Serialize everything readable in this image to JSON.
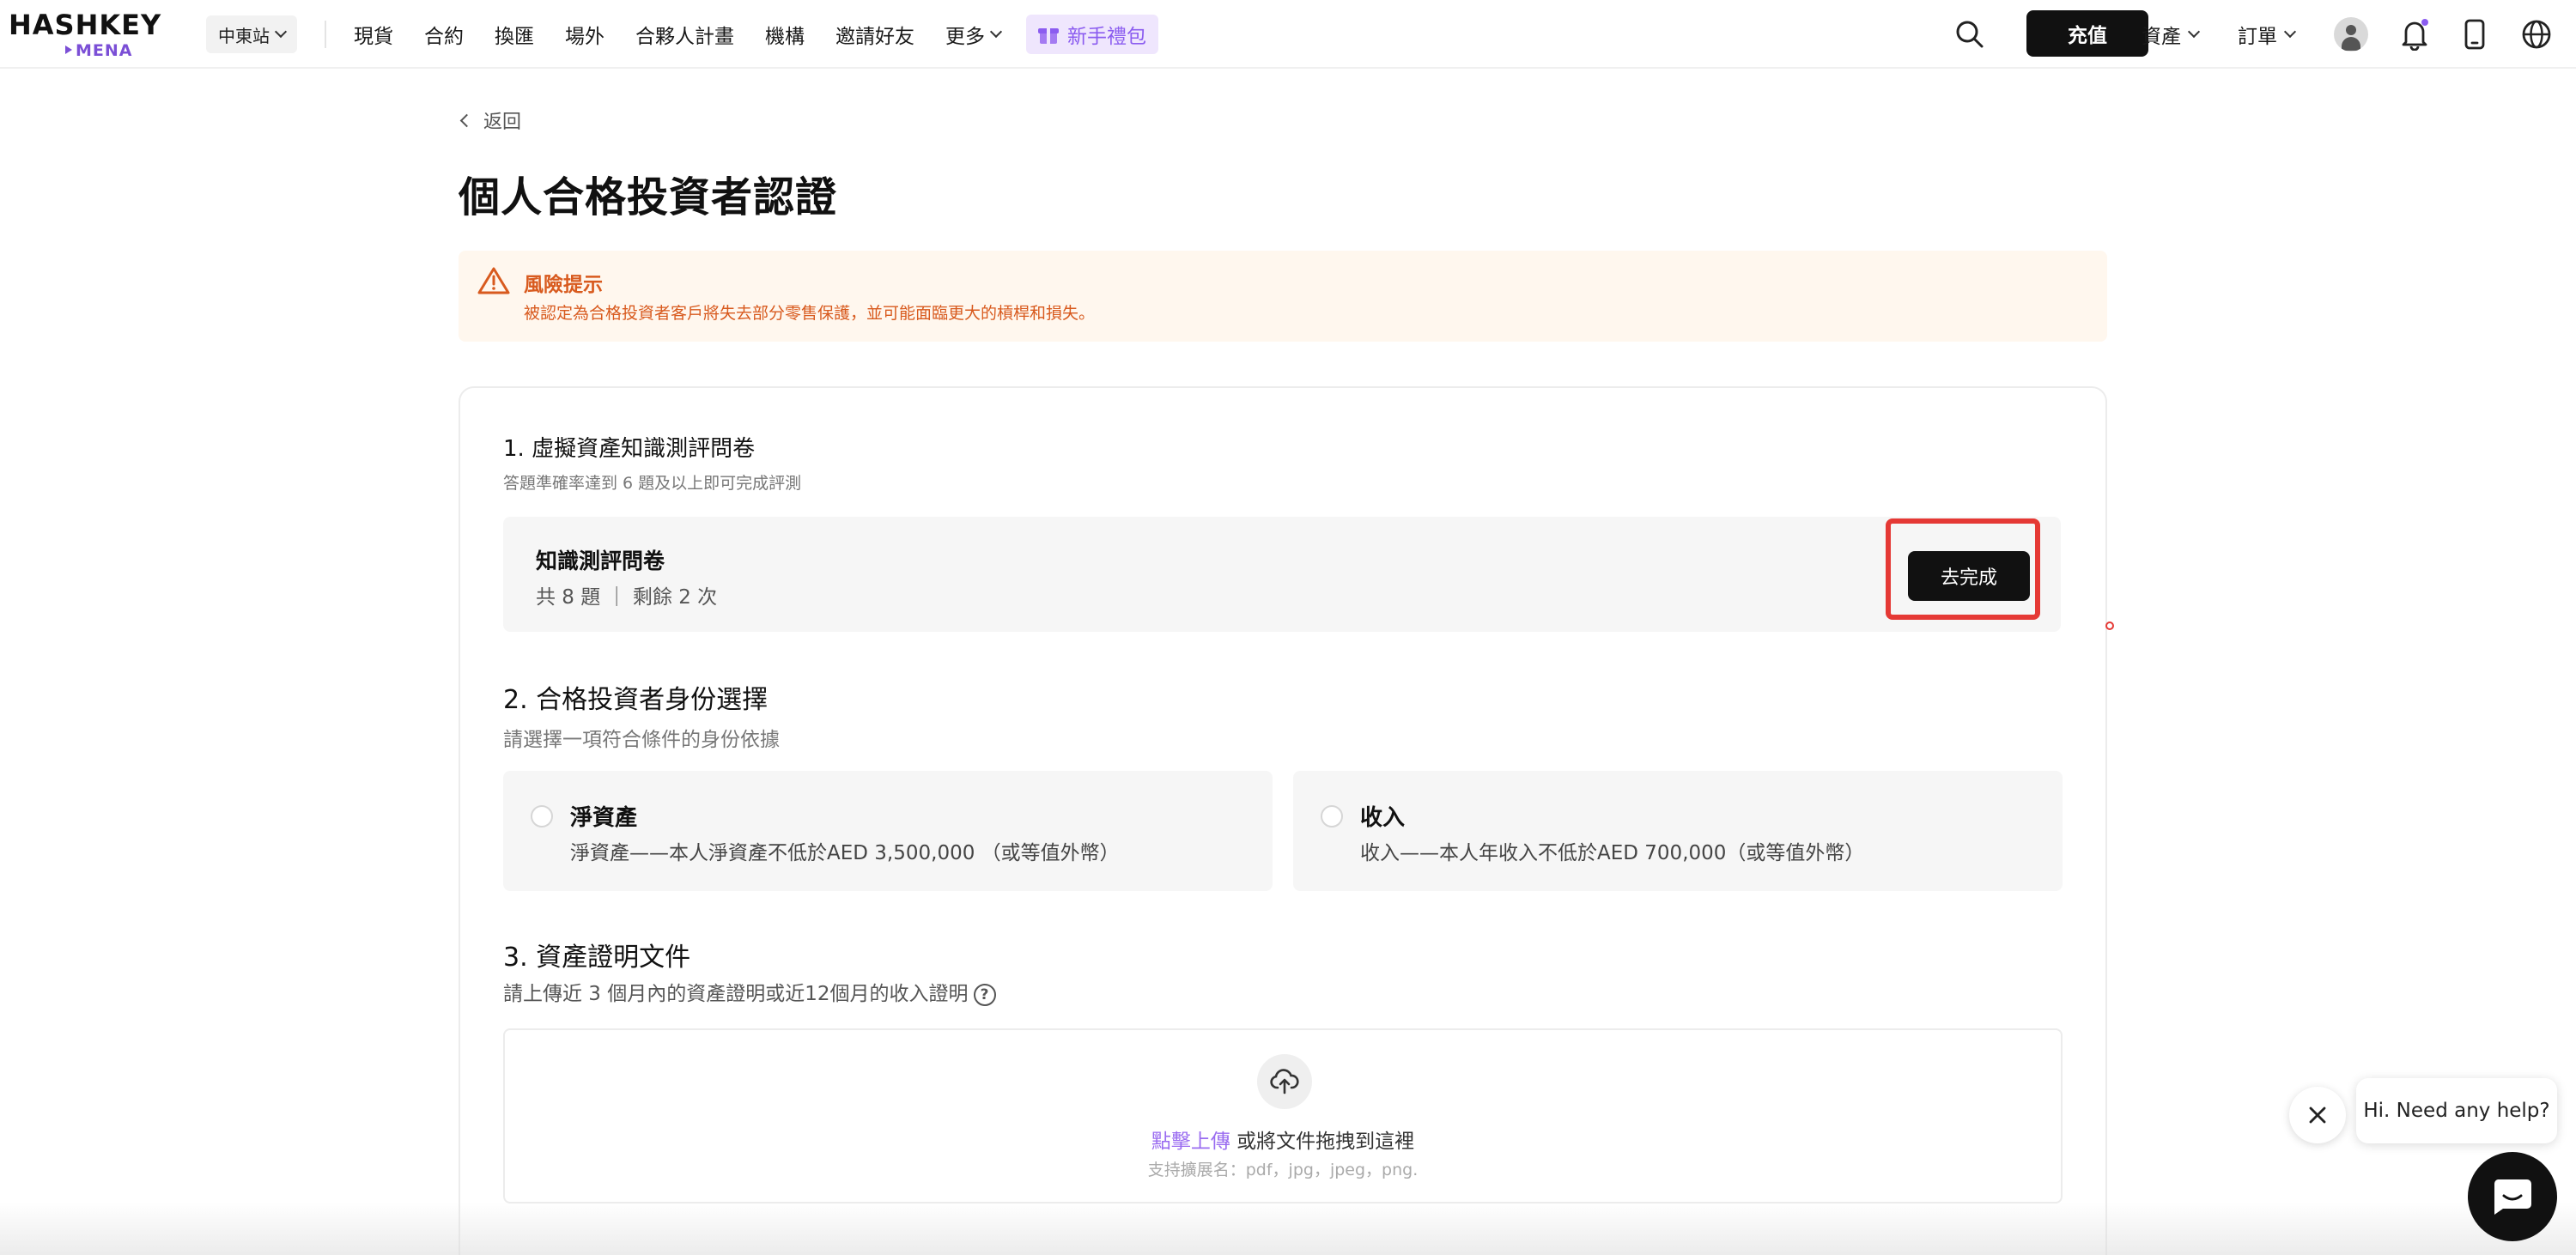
{
  "brand": {
    "logo_main": "HASHKEY",
    "logo_sub": "MENA",
    "accent": "#8b5cf0",
    "primary_button": "#111111",
    "warning": "#d85a1e"
  },
  "header": {
    "region": "中東站",
    "nav": [
      "現貨",
      "合約",
      "換匯",
      "場外",
      "合夥人計畫",
      "機構",
      "邀請好友"
    ],
    "more": "更多",
    "gift": "新手禮包",
    "recharge": "充值",
    "assets": "資產",
    "orders": "訂單",
    "icons": [
      "search-icon",
      "user-avatar-icon",
      "bell-icon",
      "mobile-icon",
      "globe-icon"
    ]
  },
  "page": {
    "back": "返回",
    "title": "個人合格投資者認證"
  },
  "risk": {
    "title": "風險提示",
    "text": "被認定為合格投資者客戶將失去部分零售保護，並可能面臨更大的槓桿和損失。"
  },
  "section1": {
    "title": "1. 虛擬資產知識測評問卷",
    "sub": "答題準確率達到 6 題及以上即可完成評測",
    "quiz_title": "知識測評問卷",
    "quiz_info": "共 8 題 ｜ 剩餘 2 次",
    "button": "去完成"
  },
  "section2": {
    "title": "2. 合格投資者身份選擇",
    "sub": "請選擇一項符合條件的身份依據",
    "options": [
      {
        "title": "淨資產",
        "desc": "淨資產——本人淨資產不低於AED 3,500,000 （或等值外幣）"
      },
      {
        "title": "收入",
        "desc": "收入——本人年收入不低於AED 700,000（或等值外幣）"
      }
    ]
  },
  "section3": {
    "title": "3. 資產證明文件",
    "sub": "請上傳近 3 個月內的資產證明或近12個月的收入證明",
    "upload_link": "點擊上傳",
    "upload_text": " 或將文件拖拽到這裡",
    "upload_hint": "支持擴展名：pdf，jpg，jpeg，png."
  },
  "chat": {
    "bubble": "Hi. Need any help?"
  }
}
